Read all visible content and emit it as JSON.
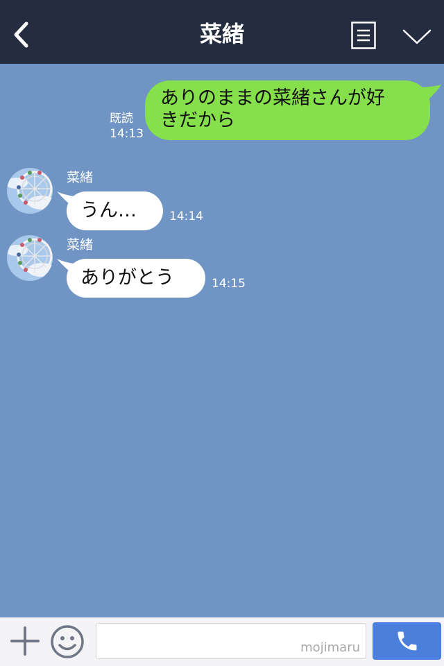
{
  "header": {
    "title": "菜緒",
    "back_icon": "chevron-left-icon",
    "menu_icon": "list-menu-icon",
    "collapse_icon": "chevron-down-icon",
    "background": "#242c40"
  },
  "chat": {
    "background": "#7094c3",
    "messages": [
      {
        "direction": "outgoing",
        "text_line1": "ありのままの菜緒さんが好",
        "text_line2": "きだから",
        "read_label": "既読",
        "time": "14:13",
        "bubble_color": "#85e04b"
      },
      {
        "direction": "incoming",
        "sender": "菜緒",
        "text": "うん…",
        "time": "14:14",
        "avatar_icon": "ferris-wheel-avatar"
      },
      {
        "direction": "incoming",
        "sender": "菜緒",
        "text": "ありがとう",
        "time": "14:15",
        "avatar_icon": "ferris-wheel-avatar"
      }
    ]
  },
  "bottom_bar": {
    "plus_icon": "plus-icon",
    "emoji_icon": "smiley-icon",
    "input_value": "",
    "watermark": "mojimaru",
    "call_icon": "phone-icon",
    "call_button_color": "#4a7fdc"
  }
}
